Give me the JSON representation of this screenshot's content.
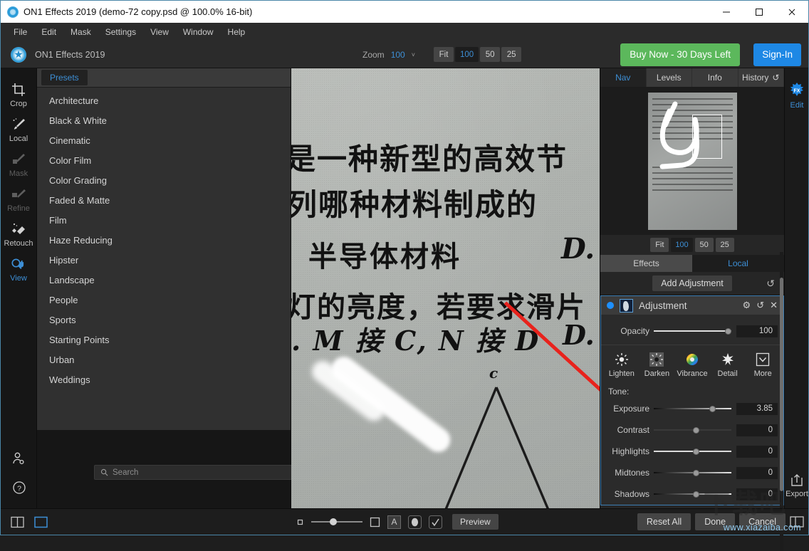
{
  "window": {
    "title": "ON1 Effects 2019 (demo-72 copy.psd @ 100.0% 16-bit)",
    "minimize": "—",
    "maximize": "□",
    "close": "✕"
  },
  "menubar": [
    "File",
    "Edit",
    "Mask",
    "Settings",
    "View",
    "Window",
    "Help"
  ],
  "toolbar": {
    "brand": "ON1 Effects 2019",
    "zoom_label": "Zoom",
    "zoom_value": "100",
    "zoom_caret": "˅",
    "zoom_buttons": [
      "Fit",
      "100",
      "50",
      "25"
    ],
    "zoom_active": "100",
    "buy_label": "Buy Now - 30 Days Left",
    "signin_label": "Sign-In",
    "buy_color": "#5cb85c",
    "signin_color": "#1e88e5"
  },
  "tools": [
    {
      "label": "Crop",
      "icon": "crop-icon",
      "state": "normal"
    },
    {
      "label": "Local",
      "icon": "local-brush-icon",
      "state": "normal"
    },
    {
      "label": "Mask",
      "icon": "mask-brush-icon",
      "state": "disabled"
    },
    {
      "label": "Refine",
      "icon": "refine-brush-icon",
      "state": "disabled"
    },
    {
      "label": "Retouch",
      "icon": "retouch-icon",
      "state": "normal"
    },
    {
      "label": "View",
      "icon": "view-pan-icon",
      "state": "active"
    }
  ],
  "rail_bottom": [
    {
      "icon": "user-settings-icon"
    },
    {
      "icon": "help-question-icon"
    }
  ],
  "presets": {
    "tab_label": "Presets",
    "items": [
      "Architecture",
      "Black & White",
      "Cinematic",
      "Color Film",
      "Color Grading",
      "Faded & Matte",
      "Film",
      "Haze Reducing",
      "Hipster",
      "Landscape",
      "People",
      "Sports",
      "Starting Points",
      "Urban",
      "Weddings"
    ],
    "search_placeholder": "Search",
    "search_value": ""
  },
  "canvas": {
    "lines": {
      "l1": "是一种新型的高效节",
      "l2": "列哪种材料制成的",
      "l3": "半导体材料",
      "l4": "灯的亮度，若要求滑片",
      "l5": ". M 接 C, N 接 D",
      "dA": "D.",
      "dB": "D.",
      "cc": "c"
    }
  },
  "right_panel": {
    "nav_tabs": [
      "Nav",
      "Levels",
      "Info",
      "History"
    ],
    "nav_active": "Nav",
    "history_icon": "↺",
    "nav_zoom_buttons": [
      "Fit",
      "100",
      "50",
      "25"
    ],
    "nav_zoom_active": "100",
    "mode_tabs": [
      "Effects",
      "Local"
    ],
    "mode_active": "Local",
    "add_adjustment": "Add Adjustment",
    "reset_icon": "↺",
    "adjustment": {
      "title": "Adjustment",
      "gear_icon": "⚙",
      "revert_icon": "↺",
      "close_icon": "✕",
      "opacity_label": "Opacity",
      "opacity_value": "100",
      "quick_tools": [
        {
          "label": "Lighten",
          "icon": "sun-lighten-icon"
        },
        {
          "label": "Darken",
          "icon": "sun-darken-icon"
        },
        {
          "label": "Vibrance",
          "icon": "color-wheel-icon"
        },
        {
          "label": "Detail",
          "icon": "sparkle-detail-icon"
        },
        {
          "label": "More",
          "icon": "chevron-down-box-icon"
        }
      ],
      "tone_label": "Tone:",
      "sliders": [
        {
          "label": "Exposure",
          "value": "3.85",
          "pos": 72
        },
        {
          "label": "Contrast",
          "value": "0",
          "pos": 50
        },
        {
          "label": "Highlights",
          "value": "0",
          "pos": 50
        },
        {
          "label": "Midtones",
          "value": "0",
          "pos": 50
        },
        {
          "label": "Shadows",
          "value": "0",
          "pos": 50
        }
      ]
    },
    "edge": {
      "edit_label": "Edit",
      "edit_icon": "fx-burst-icon",
      "export_label": "Export",
      "export_icon": "export-up-icon"
    }
  },
  "bottom_bar": {
    "left_icons": [
      "compare-split-icon",
      "single-view-icon"
    ],
    "brush_small_icon": "small-square-icon",
    "brush_large_icon": "large-square-icon",
    "slider_value": "",
    "toggles": [
      "letter-a-icon",
      "ellipse-mask-icon",
      "checkbox-mask-icon"
    ],
    "preview_label": "Preview",
    "buttons": [
      "Reset All",
      "Done",
      "Cancel"
    ],
    "panel_toggle_icon": "panel-toggle-icon"
  },
  "watermark": {
    "url": "www.xiazaiba.com",
    "cjk": "下载吧"
  }
}
